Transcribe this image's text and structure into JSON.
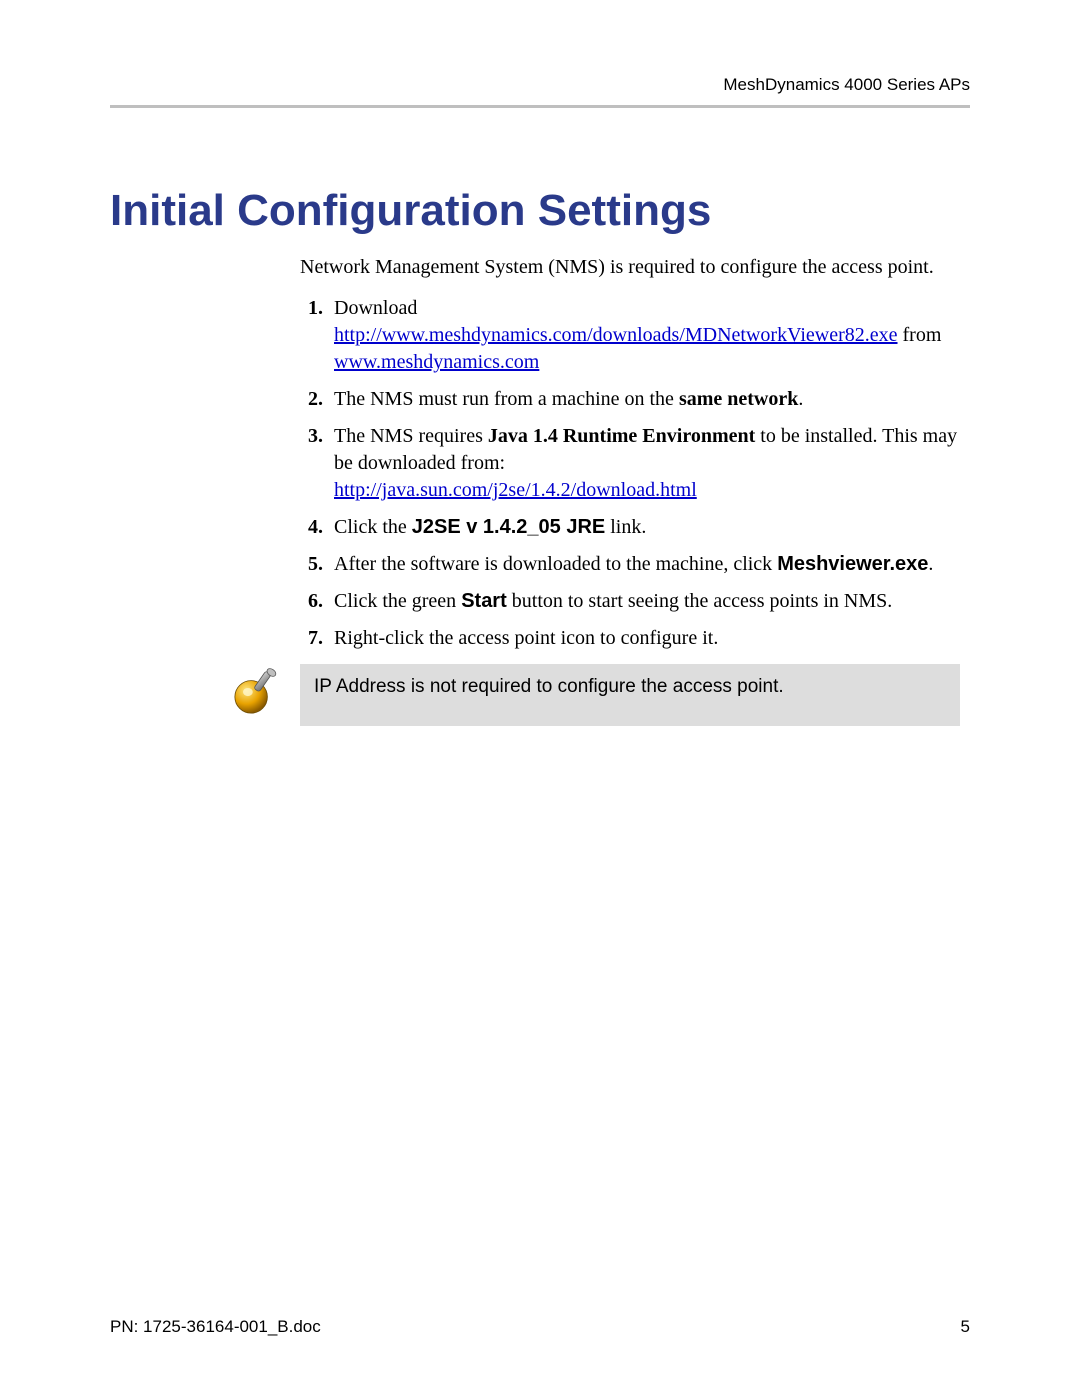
{
  "header": {
    "running_head": "MeshDynamics 4000 Series APs"
  },
  "title": "Initial Configuration Settings",
  "intro": "Network Management System (NMS) is required to configure the access point.",
  "steps": {
    "s1_lead": "Download ",
    "s1_link1": "http://www.meshdynamics.com/downloads/MDNetworkViewer82.exe",
    "s1_mid": " from ",
    "s1_link2": "www.meshdynamics.com",
    "s2_a": "The NMS must run from a machine on the ",
    "s2_b": "same network",
    "s2_c": ".",
    "s3_a": "The NMS requires ",
    "s3_b": "Java 1.4 Runtime Environment",
    "s3_c": " to be installed. This may be downloaded from: ",
    "s3_link": "http://java.sun.com/j2se/1.4.2/download.html",
    "s4_a": "Click the ",
    "s4_b": "J2SE v 1.4.2_05 JRE",
    "s4_c": " link.",
    "s5_a": "After the software is downloaded to the machine, click ",
    "s5_b": "Meshviewer.exe",
    "s5_c": ".",
    "s6_a": "Click the green ",
    "s6_b": "Start",
    "s6_c": " button to start seeing the access points in NMS.",
    "s7": "Right-click the access point icon to configure it."
  },
  "note": "IP Address is not required to configure the access point.",
  "footer": {
    "left": "PN: 1725-36164-001_B.doc",
    "right": "5"
  }
}
